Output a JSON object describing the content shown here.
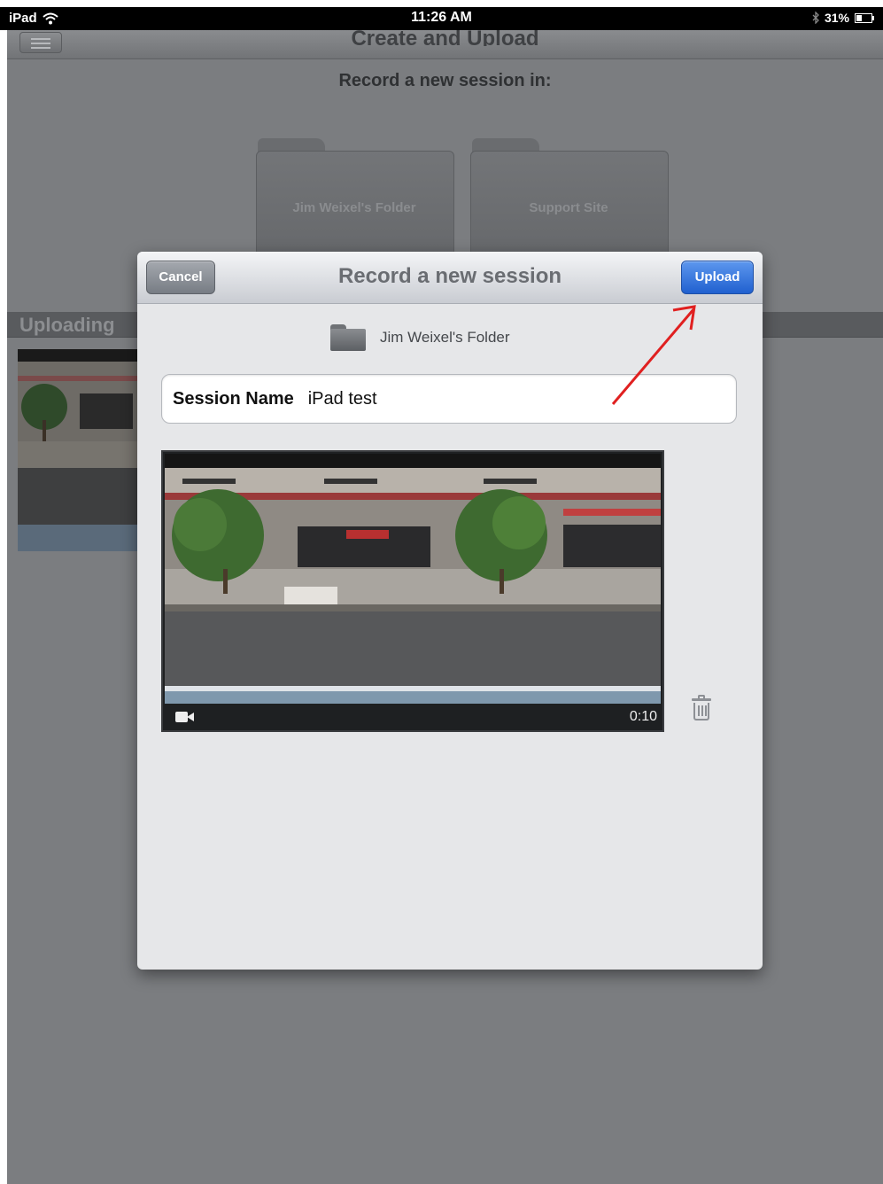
{
  "status_bar": {
    "device": "iPad",
    "time": "11:26 AM",
    "battery": "31%"
  },
  "background": {
    "title": "Create and Upload",
    "prompt": "Record a new session in:",
    "folders": [
      {
        "label": "Jim Weixel's Folder"
      },
      {
        "label": "Support Site"
      }
    ],
    "uploading_label": "Uploading"
  },
  "modal": {
    "title": "Record a new session",
    "cancel_label": "Cancel",
    "upload_label": "Upload",
    "folder_name": "Jim Weixel's Folder",
    "session_label": "Session Name",
    "session_value": "iPad test",
    "video_duration": "0:10"
  },
  "icons": [
    "wifi-icon",
    "bluetooth-icon",
    "battery-icon",
    "menu-icon",
    "folder-icon",
    "camera-icon",
    "trash-icon",
    "arrow-annotation"
  ],
  "colors": {
    "upload_button": "#2f6fdd",
    "annotation_arrow": "#e02020"
  }
}
